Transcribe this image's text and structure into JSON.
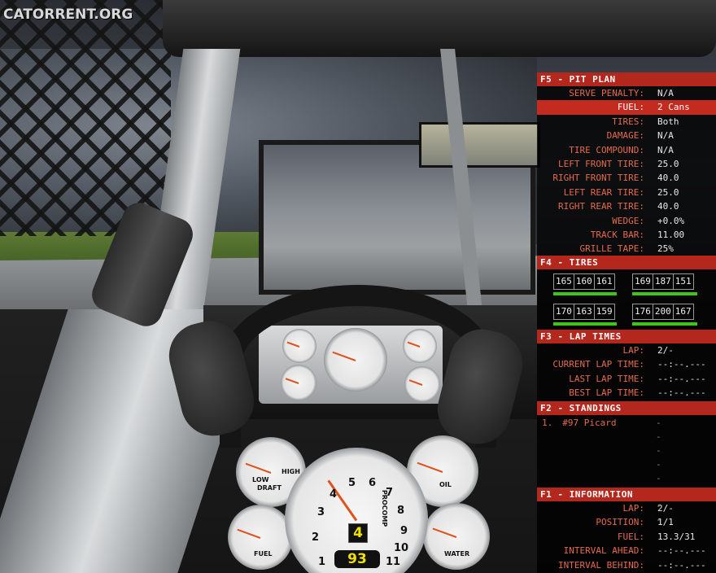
{
  "watermark": "CATORRENT.ORG",
  "hud": {
    "pit_plan": {
      "header": "F5 - PIT PLAN",
      "rows": [
        {
          "label": "SERVE PENALTY:",
          "value": "N/A"
        },
        {
          "label": "FUEL:",
          "value": "2 Cans",
          "selected": true
        },
        {
          "label": "TIRES:",
          "value": "Both"
        },
        {
          "label": "DAMAGE:",
          "value": "N/A"
        },
        {
          "label": "TIRE COMPOUND:",
          "value": "N/A"
        },
        {
          "label": "LEFT FRONT TIRE:",
          "value": "25.0"
        },
        {
          "label": "RIGHT FRONT TIRE:",
          "value": "40.0"
        },
        {
          "label": "LEFT REAR TIRE:",
          "value": "25.0"
        },
        {
          "label": "RIGHT REAR TIRE:",
          "value": "40.0"
        },
        {
          "label": "WEDGE:",
          "value": "+0.0%"
        },
        {
          "label": "TRACK BAR:",
          "value": "11.00"
        },
        {
          "label": "GRILLE TAPE:",
          "value": "25%"
        }
      ]
    },
    "tires": {
      "header": "F4 - TIRES",
      "left_front": [
        "165",
        "160",
        "161"
      ],
      "right_front": [
        "169",
        "187",
        "151"
      ],
      "left_rear": [
        "170",
        "163",
        "159"
      ],
      "right_rear": [
        "176",
        "200",
        "167"
      ],
      "wear_color": "#3ec51a"
    },
    "lap_times": {
      "header": "F3 - LAP TIMES",
      "rows": [
        {
          "label": "LAP:",
          "value": "2/-"
        },
        {
          "label": "CURRENT LAP TIME:",
          "value": "--:--.---"
        },
        {
          "label": "LAST LAP TIME:",
          "value": "--:--.---"
        },
        {
          "label": "BEST LAP TIME:",
          "value": "--:--.---"
        }
      ]
    },
    "standings": {
      "header": "F2 - STANDINGS",
      "rows": [
        {
          "pos": "1.",
          "car": "#97 Picard",
          "gap": "--------"
        }
      ]
    },
    "information": {
      "header": "F1 - INFORMATION",
      "rows": [
        {
          "label": "LAP:",
          "value": "2/-"
        },
        {
          "label": "POSITION:",
          "value": "1/1"
        },
        {
          "label": "FUEL:",
          "value": "13.3/31"
        },
        {
          "label": "INTERVAL AHEAD:",
          "value": "--:--.---"
        },
        {
          "label": "INTERVAL BEHIND:",
          "value": "--:--.---"
        }
      ]
    }
  },
  "dashboard": {
    "gear": "4",
    "speed": "93",
    "tach_numbers": [
      "1",
      "2",
      "3",
      "4",
      "5",
      "6",
      "7",
      "8",
      "9",
      "10",
      "11"
    ],
    "tach_brand": "PROCOMP",
    "gauge_labels": {
      "draft": "DRAFT",
      "draft_high": "HIGH",
      "draft_low": "LOW",
      "fuel": "FUEL",
      "oil": "OIL",
      "water": "WATER"
    },
    "accent_color": "#e0521c",
    "hud_header_color": "#b3271c"
  }
}
